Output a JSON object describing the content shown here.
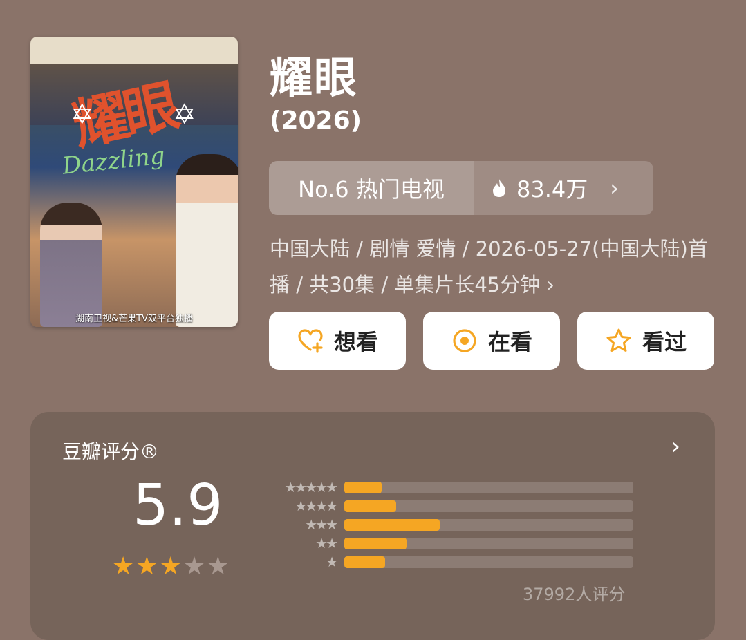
{
  "poster": {
    "title_art": "耀眼",
    "subtitle_art": "Dazzling",
    "caption": "湖南卫视&芒果TV双平台独播"
  },
  "show": {
    "title": "耀眼",
    "year": "(2026)"
  },
  "rank": {
    "label": "No.6 热门电视",
    "heat": "83.4万"
  },
  "meta": {
    "text": "中国大陆 / 剧情 爱情 / 2026-05-27(中国大陆)首播 / 共30集 / 单集片长45分钟 ›"
  },
  "actions": {
    "want": "想看",
    "watching": "在看",
    "watched": "看过"
  },
  "rating": {
    "heading": "豆瓣评分®",
    "score": "5.9",
    "stars": 3,
    "max_stars": 5,
    "count_text": "37992人评分",
    "distribution": [
      {
        "stars": 5,
        "label": "★★★★★",
        "fraction": 0.13
      },
      {
        "stars": 4,
        "label": "★★★★",
        "fraction": 0.18
      },
      {
        "stars": 3,
        "label": "★★★",
        "fraction": 0.33
      },
      {
        "stars": 2,
        "label": "★★",
        "fraction": 0.215
      },
      {
        "stars": 1,
        "label": "★",
        "fraction": 0.14
      }
    ]
  },
  "colors": {
    "background": "#8a7369",
    "accent": "#f5a623",
    "star_empty": "#a89890"
  }
}
